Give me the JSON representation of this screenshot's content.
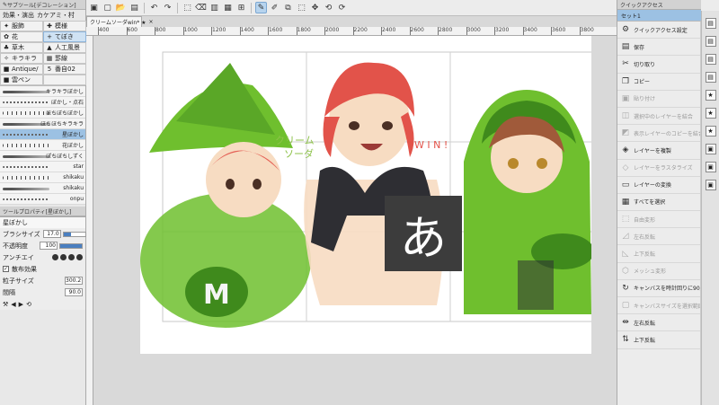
{
  "toolbar": {
    "icons": [
      "canvas-icon",
      "new-icon",
      "open-icon",
      "save-icon",
      "undo-icon",
      "redo-icon",
      "transform-icon",
      "clear-icon",
      "fill-icon",
      "grid-icon",
      "ruler-icon",
      "pen-active-icon",
      "pen2-icon",
      "crop-icon",
      "select-icon",
      "move-icon",
      "rotate-left-icon",
      "rotate-right-icon"
    ]
  },
  "left": {
    "sub_tool_title": "サブツール[デコレーション]",
    "tabs": [
      "効果・演出",
      "カケアミ・村"
    ],
    "grid": [
      {
        "icon": "✦",
        "label": "服飾"
      },
      {
        "icon": "✚",
        "label": "模様"
      },
      {
        "icon": "✿",
        "label": "花"
      },
      {
        "icon": "+",
        "label": "てぼき"
      },
      {
        "icon": "♣",
        "label": "草木"
      },
      {
        "icon": "▲",
        "label": "人工風景"
      },
      {
        "icon": "✧",
        "label": "キラキラ"
      },
      {
        "icon": "▦",
        "label": "罫線"
      },
      {
        "icon": "■",
        "label": "Antique/"
      },
      {
        "icon": "5",
        "label": "番自02"
      },
      {
        "icon": "■",
        "label": "雲ペン"
      },
      {
        "icon": "",
        "label": ""
      }
    ],
    "brushes": [
      {
        "name": "キラキラぼかし"
      },
      {
        "name": "ぼかし・点石"
      },
      {
        "name": "ほちぼちぼかし"
      },
      {
        "name": "ほちほちキラキラ"
      },
      {
        "name": "星ぼかし"
      },
      {
        "name": "花ぼかし"
      },
      {
        "name": "ぽちぼちしずく"
      },
      {
        "name": "star"
      },
      {
        "name": "shikaku"
      },
      {
        "name": "shikaku"
      },
      {
        "name": "onpu"
      }
    ],
    "brush_selected_index": 4,
    "tool_property_title": "ツールプロパティ[星ぼかし]",
    "current_tool": "星ぼかし",
    "props": {
      "brush_size_label": "ブラシサイズ",
      "brush_size_value": "17.0",
      "brush_size_fraction": 0.35,
      "opacity_label": "不透明度",
      "opacity_value": "100",
      "opacity_fraction": 1.0,
      "antialias_label": "アンチエイ",
      "scatter_label": "散布効果",
      "particle_label": "粒子サイズ",
      "particle_value": "300.2",
      "interval_label": "間隔",
      "interval_value": "90.0"
    }
  },
  "document": {
    "tab_label": "クリームソーダwin* ★"
  },
  "ruler": {
    "ticks": [
      "400",
      "600",
      "800",
      "1000",
      "1200",
      "1400",
      "1600",
      "1800",
      "2000",
      "2200",
      "2400",
      "2600",
      "2800",
      "3000",
      "3200",
      "3400",
      "3600",
      "3800"
    ]
  },
  "canvas": {
    "ime_char": "あ",
    "colors": {
      "green": "#6fbf2e",
      "dark_green": "#3f8a1c",
      "hair_red": "#e2534a",
      "hair_brown": "#a05a3a",
      "skin": "#f7dcc2",
      "dark": "#2e2e33"
    }
  },
  "right": {
    "panel_title": "クイックアクセス",
    "set_label": "セット1",
    "items": [
      {
        "icon": "⚙",
        "label": "クイックアクセス設定",
        "disabled": false
      },
      {
        "icon": "▤",
        "label": "保存",
        "disabled": false
      },
      {
        "icon": "✂",
        "label": "切り取り",
        "disabled": false
      },
      {
        "icon": "❐",
        "label": "コピー",
        "disabled": false
      },
      {
        "icon": "▣",
        "label": "貼り付け",
        "disabled": true
      },
      {
        "icon": "◫",
        "label": "選択中のレイヤーを結合",
        "disabled": true
      },
      {
        "icon": "◩",
        "label": "表示レイヤーのコピーを結合",
        "disabled": true
      },
      {
        "icon": "◈",
        "label": "レイヤーを複製",
        "disabled": false
      },
      {
        "icon": "◇",
        "label": "レイヤーをラスタライズ",
        "disabled": true
      },
      {
        "icon": "▭",
        "label": "レイヤーの変換",
        "disabled": false
      },
      {
        "icon": "▦",
        "label": "すべてを選択",
        "disabled": false
      },
      {
        "icon": "⬚",
        "label": "自由変形",
        "disabled": true
      },
      {
        "icon": "◿",
        "label": "左右反転",
        "disabled": true
      },
      {
        "icon": "◺",
        "label": "上下反転",
        "disabled": true
      },
      {
        "icon": "⬡",
        "label": "メッシュ変形",
        "disabled": true
      },
      {
        "icon": "↻",
        "label": "キャンバスを時計回りに90度回転",
        "disabled": false
      },
      {
        "icon": "▢",
        "label": "キャンバスサイズを選択範囲に合わせる",
        "disabled": true
      },
      {
        "icon": "⇹",
        "label": "左右反転",
        "disabled": false
      },
      {
        "icon": "⇅",
        "label": "上下反転",
        "disabled": false
      }
    ]
  }
}
